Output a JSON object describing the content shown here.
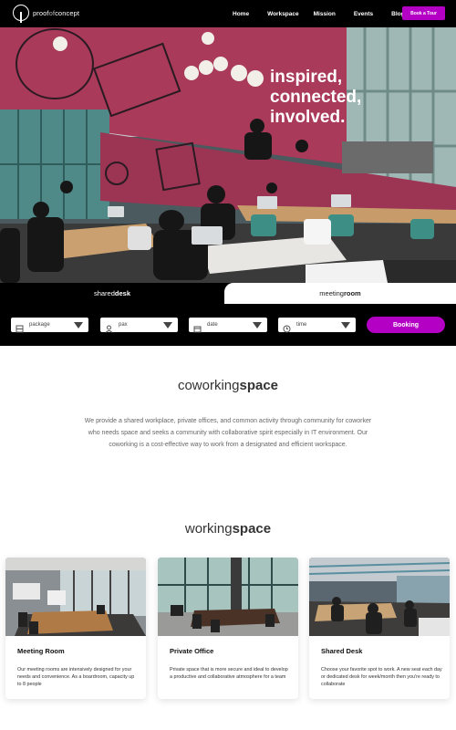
{
  "nav": {
    "logo_text_a": "proof",
    "logo_text_b": "of",
    "logo_text_c": "concept",
    "links": [
      "Home",
      "Workspace",
      "Mission",
      "Events",
      "Blog"
    ],
    "tour_button": "Book a Tour"
  },
  "hero": {
    "wall_text": [
      "inspired,",
      "connected,",
      "involved."
    ]
  },
  "booking": {
    "tab_shared_a": "shared",
    "tab_shared_b": "desk",
    "tab_meeting_a": "meeting",
    "tab_meeting_b": "room",
    "fields": [
      "package",
      "pax",
      "date",
      "time"
    ],
    "button": "Booking"
  },
  "coworking": {
    "title_a": "coworking",
    "title_b": "space",
    "text": "We provide a shared workplace, private offices, and common activity through community for coworker who needs space and seeks a community with collaborative spirit especially in IT environment. Our coworking is a cost-effective way to work from a designated and efficient workspace."
  },
  "working": {
    "title_a": "working",
    "title_b": "space",
    "cards": [
      {
        "title": "Meeting Room",
        "desc": "Our meeting rooms are intensively designed for your needs and convenience. As a boardroom, capacity up to 8 people"
      },
      {
        "title": "Private Office",
        "desc": "Private space that is more secure and ideal to develop a productive and collaborative atmosphere for a team"
      },
      {
        "title": "Shared Desk",
        "desc": "Choose your favorite spot to work. A new seat each day or dedicated desk for week/month then you're ready to collaborate"
      }
    ]
  },
  "colors": {
    "accent": "#b300c4",
    "nav_bg": "#000000",
    "wall": "#a93a5a"
  }
}
